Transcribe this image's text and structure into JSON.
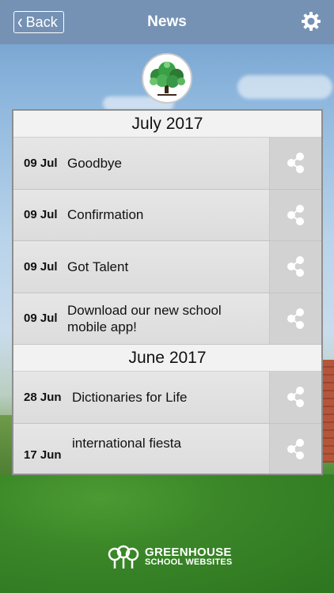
{
  "header": {
    "back_label": "Back",
    "title": "News",
    "settings_icon": "gear-icon"
  },
  "logo_icon": "tree-icon",
  "sections": [
    {
      "title": "July 2017",
      "items": [
        {
          "date": "09 Jul",
          "title": "Goodbye"
        },
        {
          "date": "09 Jul",
          "title": "Confirmation"
        },
        {
          "date": "09 Jul",
          "title": "Got Talent"
        },
        {
          "date": "09 Jul",
          "title": "Download our new school mobile app!"
        }
      ]
    },
    {
      "title": "June 2017",
      "items": [
        {
          "date": "28 Jun",
          "title": "Dictionaries for Life"
        },
        {
          "date": "17 Jun",
          "title": "international fiesta"
        }
      ]
    }
  ],
  "share_icon": "share-icon",
  "footer": {
    "line1": "GREENHOUSE",
    "line2": "SCHOOL WEBSITES"
  }
}
